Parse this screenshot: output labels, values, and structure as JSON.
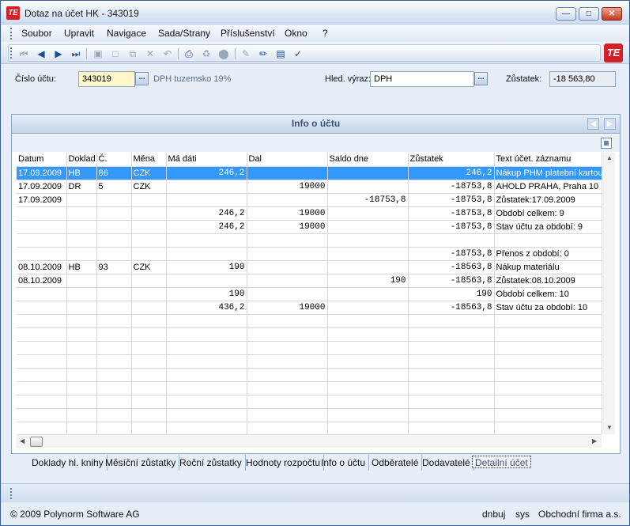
{
  "window": {
    "title": "Dotaz na účet HK - 343019",
    "app_icon": "TE",
    "controls": [
      "minimize-icon",
      "maximize-icon",
      "close-icon"
    ]
  },
  "menu": [
    "Soubor",
    "Upravit",
    "Navigace",
    "Sada/Strany",
    "Příslušenství",
    "Okno",
    "?"
  ],
  "toolbar": {
    "icons": [
      "first-record-icon",
      "prev-record-icon",
      "next-record-icon",
      "last-record-icon",
      "save-icon",
      "new-icon",
      "copy-icon",
      "delete-icon",
      "undo-icon",
      "print-icon",
      "tree-icon",
      "stop-icon",
      "edit-icon",
      "edit-clear-icon",
      "export-icon",
      "filter-icon"
    ]
  },
  "form": {
    "account_label": "Číslo účtu:",
    "account_value": "343019",
    "dots": "...",
    "account_desc": "DPH tuzemsko 19%",
    "search_label": "Hled. výraz:",
    "search_value": "DPH",
    "balance_label": "Zůstatek:",
    "balance_value": "-18 563,80"
  },
  "panel": {
    "title": "Info o účtu"
  },
  "table": {
    "columns": [
      "Datum",
      "Doklad",
      "Č.",
      "Měna",
      "Má dáti",
      "Dal",
      "Saldo dne",
      "Zůstatek",
      "Text účet. záznamu"
    ],
    "rows": [
      [
        "17.09.2009",
        "HB",
        "86",
        "CZK",
        "246,2",
        "",
        "",
        "246,2",
        "Nákup PHM platební kartou"
      ],
      [
        "17.09.2009",
        "DR",
        "5",
        "CZK",
        "",
        "19000",
        "",
        "-18753,8",
        "AHOLD PRAHA, Praha 10"
      ],
      [
        "17.09.2009",
        "",
        "",
        "",
        "",
        "",
        "-18753,8",
        "-18753,8",
        "Zůstatek:17.09.2009"
      ],
      [
        "",
        "",
        "",
        "",
        "246,2",
        "19000",
        "",
        "-18753,8",
        "Období celkem: 9"
      ],
      [
        "",
        "",
        "",
        "",
        "246,2",
        "19000",
        "",
        "-18753,8",
        "Stav účtu za období:   9"
      ],
      [
        "",
        "",
        "",
        "",
        "",
        "",
        "",
        "",
        ""
      ],
      [
        "",
        "",
        "",
        "",
        "",
        "",
        "",
        "-18753,8",
        "Přenos z období:      0"
      ],
      [
        "08.10.2009",
        "HB",
        "93",
        "CZK",
        "190",
        "",
        "",
        "-18563,8",
        "Nákup materiálu"
      ],
      [
        "08.10.2009",
        "",
        "",
        "",
        "",
        "",
        "190",
        "-18563,8",
        "Zůstatek:08.10.2009"
      ],
      [
        "",
        "",
        "",
        "",
        "190",
        "",
        "",
        "190",
        "Období celkem: 10"
      ],
      [
        "",
        "",
        "",
        "",
        "436,2",
        "19000",
        "",
        "-18563,8",
        "Stav účtu za období:   10"
      ]
    ],
    "empty_rows": 9,
    "selected_row": 0
  },
  "tabs": [
    "Doklady hl. knihy",
    "Měsíční zůstatky",
    "Roční zůstatky",
    "Hodnoty rozpočtu",
    "Info o účtu",
    "Odběratelé",
    "Dodavatelé",
    "Detailní účet"
  ],
  "active_tab": 7,
  "status": {
    "copyright": "© 2009 Polynorm Software AG",
    "user": "dnbuj",
    "system": "sys",
    "company": "Obchodní firma a.s."
  },
  "colors": {
    "selection": "#3399ff",
    "brand": "#d71f27",
    "account_field": "#fdf7c9"
  }
}
